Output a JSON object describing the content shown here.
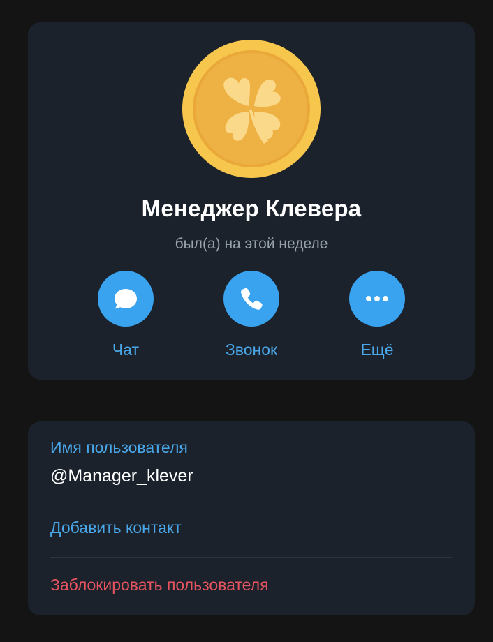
{
  "profile": {
    "name": "Менеджер Клевера",
    "status": "был(а) на этой неделе",
    "avatar_icon": "clover-coin-icon"
  },
  "actions": [
    {
      "label": "Чат",
      "icon": "chat-bubble-icon"
    },
    {
      "label": "Звонок",
      "icon": "phone-icon"
    },
    {
      "label": "Ещё",
      "icon": "more-dots-icon"
    }
  ],
  "info": {
    "username_label": "Имя пользователя",
    "username_value": "@Manager_klever",
    "add_contact_label": "Добавить контакт",
    "block_label": "Заблокировать пользователя"
  },
  "colors": {
    "background": "#141414",
    "card": "#1b222c",
    "accent": "#3aa3ef",
    "link": "#4aa8ea",
    "danger": "#e5545f",
    "coin": "#f6c450"
  }
}
